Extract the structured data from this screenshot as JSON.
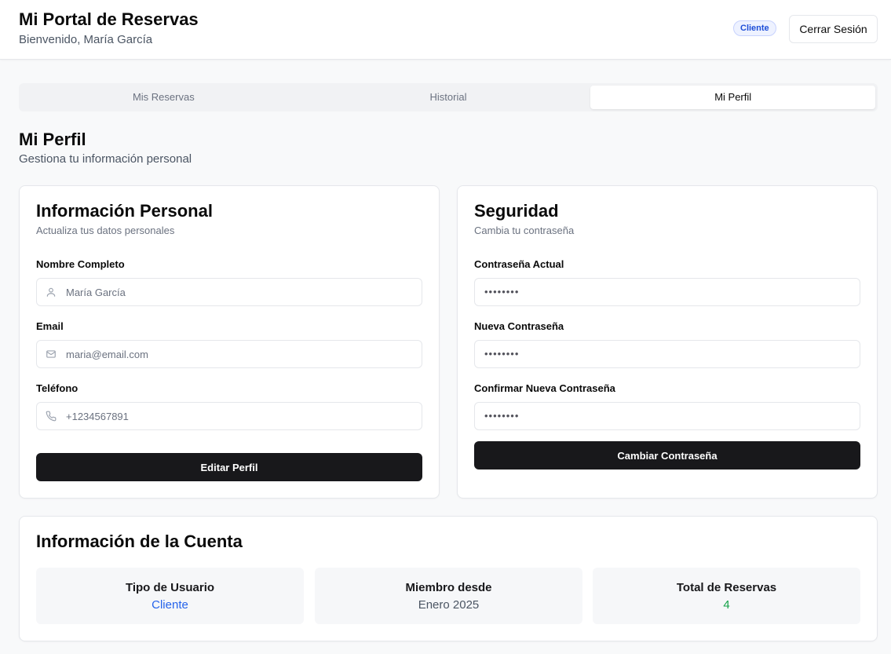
{
  "header": {
    "title": "Mi Portal de Reservas",
    "welcome": "Bienvenido, María García",
    "role_badge": "Cliente",
    "logout_label": "Cerrar Sesión"
  },
  "tabs": [
    {
      "label": "Mis Reservas",
      "active": false
    },
    {
      "label": "Historial",
      "active": false
    },
    {
      "label": "Mi Perfil",
      "active": true
    }
  ],
  "page": {
    "title": "Mi Perfil",
    "subtitle": "Gestiona tu información personal"
  },
  "personal": {
    "title": "Información Personal",
    "description": "Actualiza tus datos personales",
    "fields": [
      {
        "label": "Nombre Completo",
        "placeholder": "María García",
        "icon": "user-icon"
      },
      {
        "label": "Email",
        "placeholder": "maria@email.com",
        "icon": "mail-icon"
      },
      {
        "label": "Teléfono",
        "placeholder": "+1234567891",
        "icon": "phone-icon"
      }
    ],
    "button_label": "Editar Perfil"
  },
  "security": {
    "title": "Seguridad",
    "description": "Cambia tu contraseña",
    "fields": [
      {
        "label": "Contraseña Actual",
        "value": "••••••••"
      },
      {
        "label": "Nueva Contraseña",
        "value": "••••••••"
      },
      {
        "label": "Confirmar Nueva Contraseña",
        "value": "••••••••"
      }
    ],
    "button_label": "Cambiar Contraseña"
  },
  "account": {
    "title": "Información de la Cuenta",
    "stats": [
      {
        "label": "Tipo de Usuario",
        "value": "Cliente",
        "color": "#2563eb"
      },
      {
        "label": "Miembro desde",
        "value": "Enero 2025",
        "color": "#4b5563"
      },
      {
        "label": "Total de Reservas",
        "value": "4",
        "color": "#16a34a"
      }
    ]
  },
  "colors": {
    "primary_button": "#18181b",
    "badge_text": "#1d4ed8",
    "page_background": "#f8f9fa"
  }
}
